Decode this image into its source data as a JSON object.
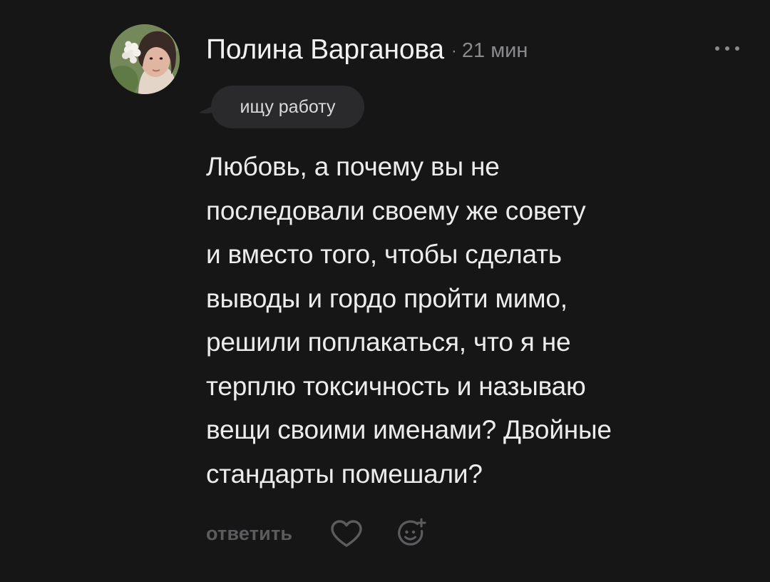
{
  "comment": {
    "author": {
      "name": "Полина Варганова",
      "avatar_alt": "avatar"
    },
    "separator": "·",
    "time_ago": "21 мин",
    "status": "ищу работу",
    "body_lines": [
      "Любовь, а почему вы не",
      "последовали своему же совету",
      "и вместо того, чтобы сделать",
      "выводы и гордо пройти мимо,",
      "решили поплакаться, что я не",
      "терплю токсичность и называю",
      "вещи своими именами? Двойные",
      "стандарты помешали?"
    ],
    "actions": {
      "reply_label": "ответить",
      "like_icon": "heart-outline-icon",
      "react_icon": "add-emoji-icon"
    }
  },
  "colors": {
    "background": "#171617",
    "text_primary": "#ececec",
    "text_muted": "#8a8a8d",
    "action_muted": "#5c5b5e",
    "bubble": "#2a292b"
  }
}
